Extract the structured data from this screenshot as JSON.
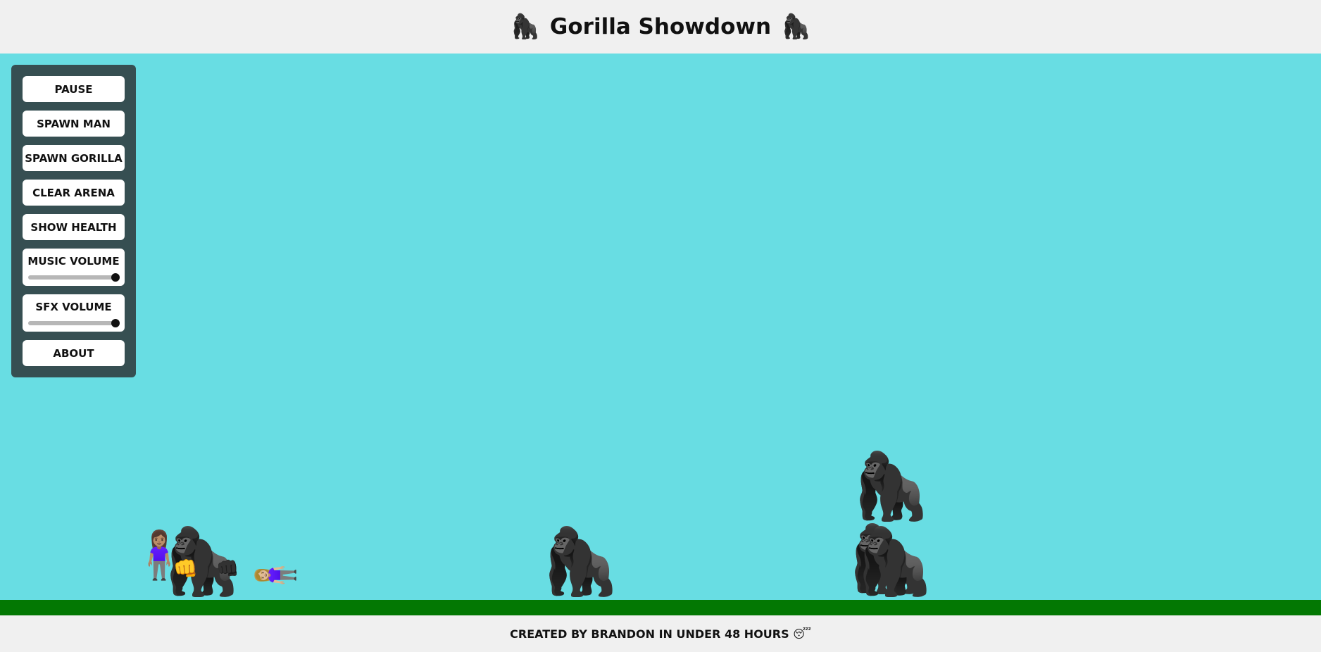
{
  "header": {
    "title": "Gorilla Showdown",
    "icon": "gorilla-icon",
    "glyph": "🦍"
  },
  "controls": {
    "pause": "PAUSE",
    "spawn_man": "SPAWN MAN",
    "spawn_gorilla": "SPAWN GORILLA",
    "clear_arena": "CLEAR ARENA",
    "show_health": "SHOW HEALTH",
    "music_volume": {
      "label": "MUSIC VOLUME",
      "value": 1.0
    },
    "sfx_volume": {
      "label": "SFX VOLUME",
      "value": 1.0
    },
    "about": "ABOUT"
  },
  "sprites": {
    "gorilla": "🦍",
    "woman": "🧍🏽‍♀️",
    "fist": "👊",
    "knocked_down": "🧍🏼‍♀️"
  },
  "footer": {
    "text": "CREATED BY BRANDON IN UNDER 48 HOURS 😴"
  },
  "colors": {
    "sky": "#68dde3",
    "ground": "#037803",
    "panel": "#364f52",
    "header_bg": "#f0f0f0"
  }
}
